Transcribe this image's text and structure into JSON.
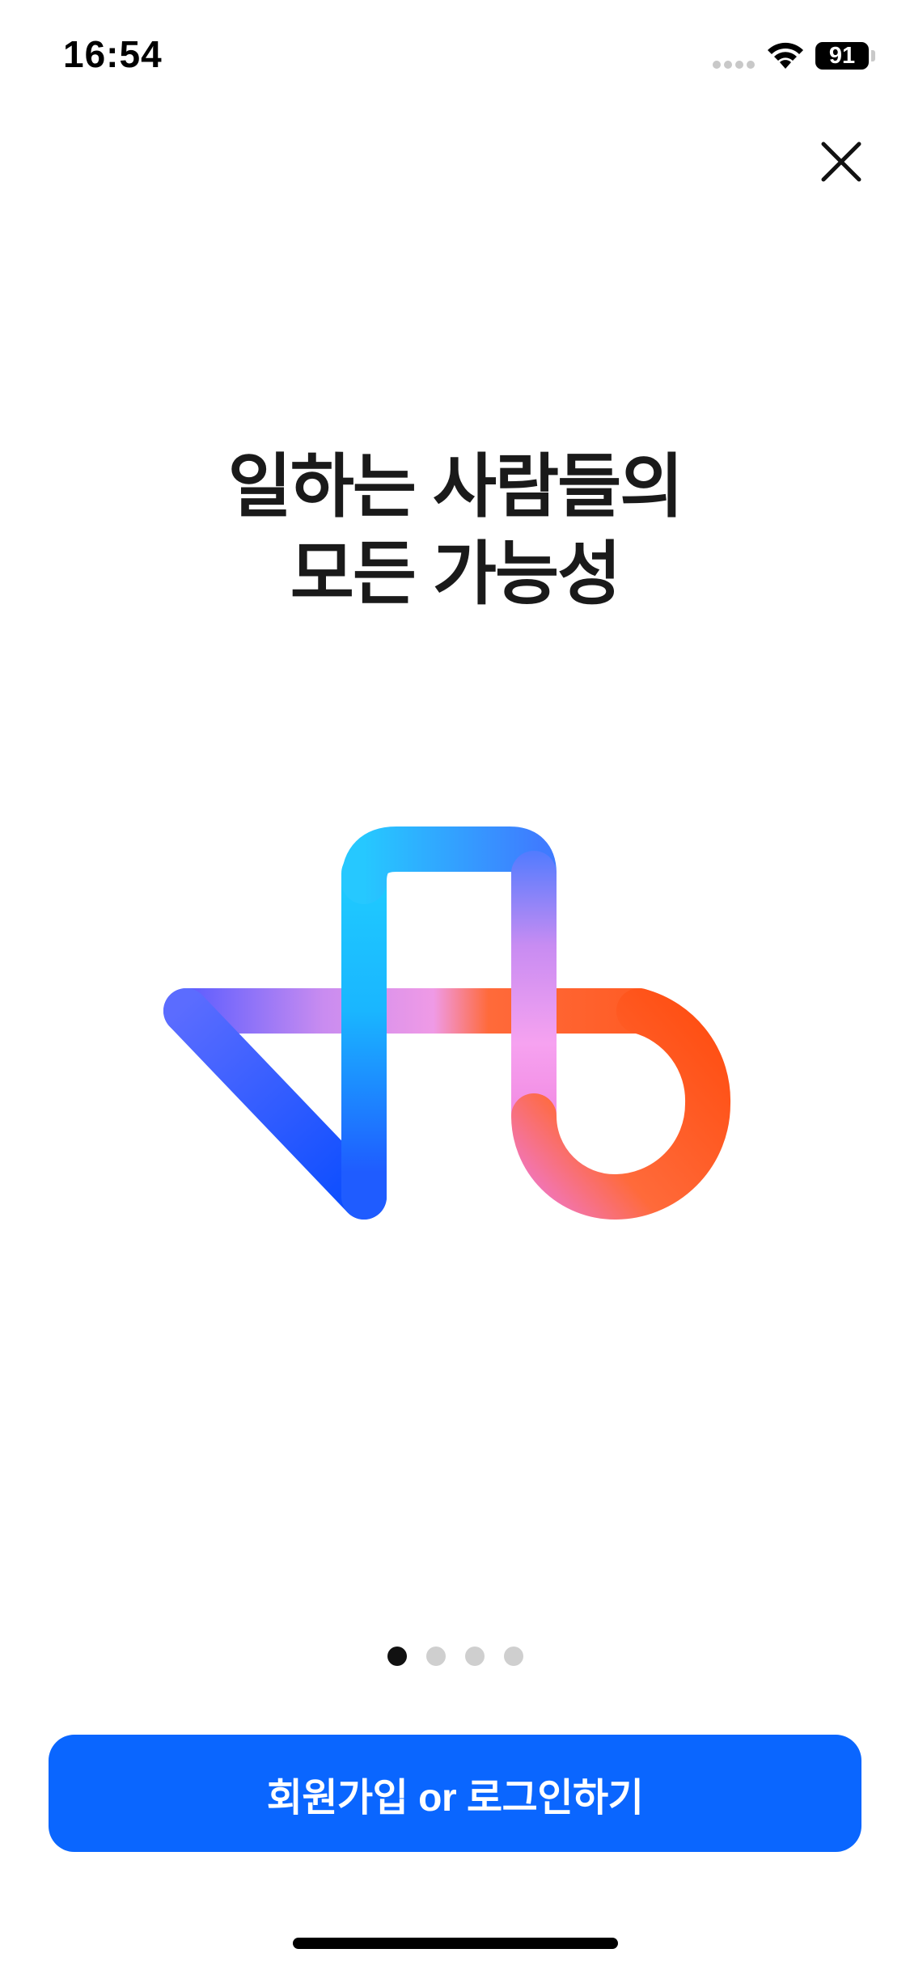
{
  "status_bar": {
    "time": "16:54",
    "battery_level": "91",
    "icons": [
      "signal-dots-icon",
      "wifi-icon",
      "battery-icon"
    ]
  },
  "header": {
    "close_icon": "close-icon"
  },
  "main": {
    "headline_line1": "일하는 사람들의",
    "headline_line2": "모든 가능성",
    "logo_icon": "brand-logo-icon"
  },
  "pager": {
    "total_pages": 4,
    "current_page": 1
  },
  "cta": {
    "label": "회원가입 or 로그인하기"
  },
  "colors": {
    "primary": "#0a66ff",
    "text": "#1a1a1a",
    "dot_active": "#111111",
    "dot_inactive": "#cfcfcf",
    "logo_blue": "#0a4dff",
    "logo_cyan": "#19c6ff",
    "logo_pink": "#f28be8",
    "logo_orange": "#ff5a1f"
  }
}
